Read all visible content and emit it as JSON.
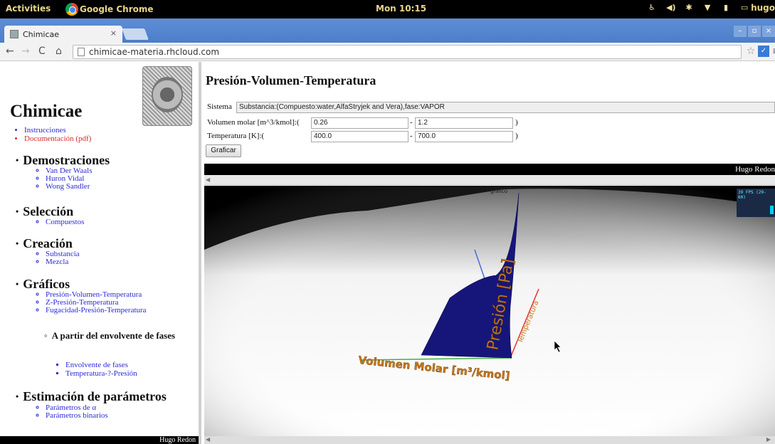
{
  "topbar": {
    "activities": "Activities",
    "app_name": "Google Chrome",
    "clock": "Mon 10:15",
    "user": "hugo"
  },
  "browser": {
    "tab_title": "Chimicae",
    "tab_close": "×",
    "url": "chimicae-materia.rhcloud.com"
  },
  "sidebar": {
    "site_title": "Chimicae",
    "top_links": [
      {
        "label": "Instrucciones",
        "color": "#2a2ad6"
      },
      {
        "label": "Documentación (pdf)",
        "color": "#d62a2a"
      }
    ],
    "sections": {
      "demostraciones": {
        "title": "Demostraciones",
        "items": [
          "Van Der Waals",
          "Huron Vidal",
          "Wong Sandler"
        ]
      },
      "seleccion": {
        "title": "Selección",
        "items": [
          "Compuestos"
        ]
      },
      "creacion": {
        "title": "Creación",
        "items": [
          "Substancia",
          "Mezcla"
        ]
      },
      "graficos": {
        "title": "Gráficos",
        "items": [
          "Presión-Volumen-Temperatura",
          "Z-Presión-Temperatura",
          "Fugacidad-Presión-Temperatura"
        ],
        "subhead": "A partir del envolvente de fases",
        "subitems": [
          "Envolvente de fases",
          "Temperatura-?-Presión"
        ]
      },
      "estimacion": {
        "title": "Estimación de parámetros",
        "items": [
          "Parámetros de α",
          "Parámetros binarios"
        ]
      }
    },
    "footer": "Hugo Redon"
  },
  "main": {
    "title": "Presión-Volumen-Temperatura",
    "sistema_label": "Sistema",
    "sistema_value": "Substancia:(Compuesto:water,AlfaStryjek and Vera),fase:VAPOR",
    "volumen_label": "Volumen molar [m^3/kmol]:(",
    "volumen_min": "0.26",
    "volumen_max": "1.2",
    "temperatura_label": "Temperatura [K]:(",
    "temperatura_min": "400.0",
    "temperatura_max": "700.0",
    "dash": "-",
    "close_paren": ")",
    "graficar": "Graficar",
    "footer": "Hugo Redon",
    "plot": {
      "x_axis_label": "Volumen Molar [m³/kmol]",
      "y_axis_label": "Presión [Pa]",
      "z_axis_label": "Temperatura",
      "top_label": "grafico",
      "fps_text": "39 FPS (29-60)",
      "surface_color": "#1a1a7a",
      "axis_text_color": "#c87818"
    }
  }
}
